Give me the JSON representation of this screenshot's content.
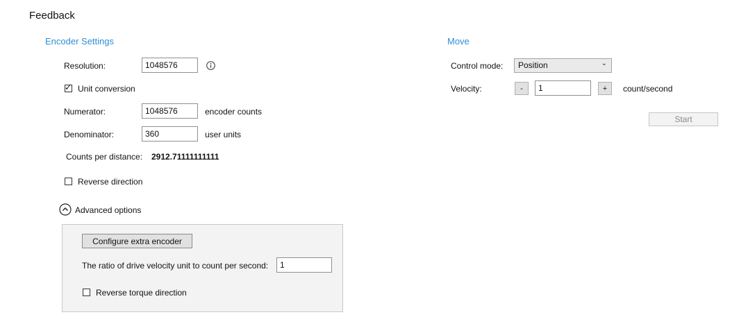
{
  "page": {
    "title": "Feedback"
  },
  "encoder": {
    "section_title": "Encoder Settings",
    "resolution_label": "Resolution:",
    "resolution_value": "1048576",
    "info_icon": "info-icon",
    "unit_conversion_label": "Unit conversion",
    "unit_conversion_checked": true,
    "numerator_label": "Numerator:",
    "numerator_value": "1048576",
    "numerator_unit": "encoder counts",
    "denominator_label": "Denominator:",
    "denominator_value": "360",
    "denominator_unit": "user units",
    "counts_per_distance_label": "Counts per distance:",
    "counts_per_distance_value": "2912.71111111111",
    "reverse_direction_label": "Reverse direction",
    "reverse_direction_checked": false
  },
  "advanced": {
    "toggle_label": "Advanced options",
    "toggle_icon": "chevron-up-circle-icon",
    "configure_button_label": "Configure extra encoder",
    "ratio_label": "The ratio of drive velocity unit to count per second:",
    "ratio_value": "1",
    "reverse_torque_label": "Reverse torque direction",
    "reverse_torque_checked": false
  },
  "move": {
    "section_title": "Move",
    "control_mode_label": "Control mode:",
    "control_mode_value": "Position",
    "velocity_label": "Velocity:",
    "velocity_decrement_label": "-",
    "velocity_value": "1",
    "velocity_increment_label": "+",
    "velocity_unit": "count/second",
    "start_button_label": "Start"
  },
  "colors": {
    "accent": "#2e8fd6",
    "panel_bg": "#f3f3f3",
    "button_bg": "#e1e1e1"
  }
}
